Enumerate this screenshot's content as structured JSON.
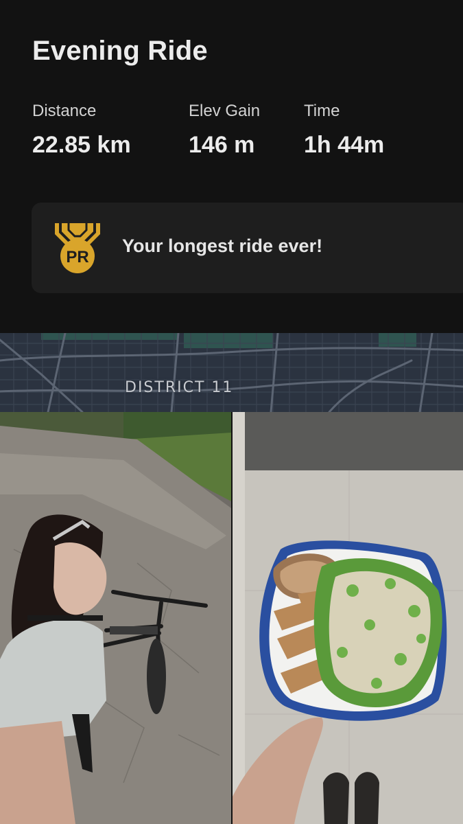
{
  "activity": {
    "title": "Evening Ride"
  },
  "stats": [
    {
      "label": "Distance",
      "value": "22.85 km"
    },
    {
      "label": "Elev Gain",
      "value": "146 m"
    },
    {
      "label": "Time",
      "value": "1h 44m"
    }
  ],
  "achievement": {
    "badge_text": "PR",
    "badge_icon": "pr-medal-icon",
    "message": "Your longest ride ever!",
    "badge_color": "#d9a52b"
  },
  "map": {
    "label": "DISTRICT 11"
  },
  "photos": [
    {
      "name": "selfie-with-bicycle-photo"
    },
    {
      "name": "salad-plate-photo"
    }
  ],
  "colors": {
    "background": "#121212",
    "card": "#1e1e1e",
    "map_base": "#2b3340"
  }
}
